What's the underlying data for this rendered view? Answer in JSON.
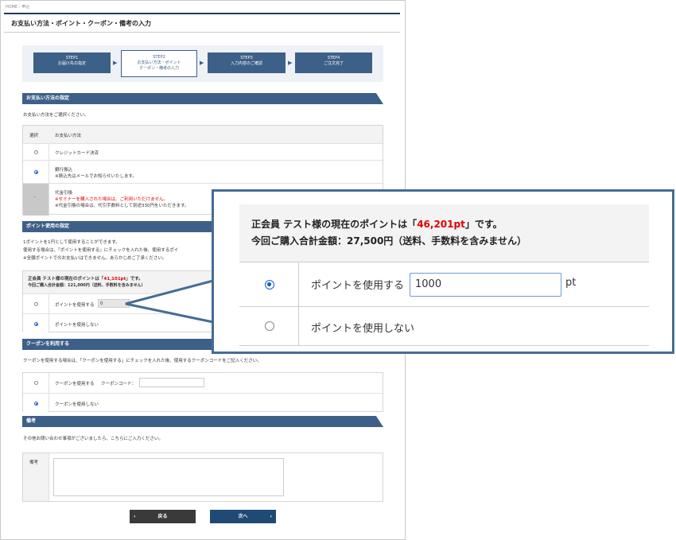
{
  "breadcrumb": {
    "home": "HOME",
    "current": "申込"
  },
  "page_title": "お支払い方法・ポイント・クーポン・備考の入力",
  "steps": [
    {
      "label": "STEP1",
      "desc": "お届け先の指定"
    },
    {
      "label": "STEP2",
      "desc": "お支払い方法・ポイント",
      "desc2": "クーポン・備考の入力"
    },
    {
      "label": "STEP3",
      "desc": "入力内容のご確認"
    },
    {
      "label": "STEP4",
      "desc": "ご注文完了"
    }
  ],
  "payment": {
    "heading": "お支払い方法の指定",
    "intro": "お支払い方法をご選択ください。",
    "col_select": "選択",
    "col_method": "お支払い方法",
    "options": {
      "credit": "クレジットカード決済",
      "bank": "銀行振込",
      "bank_note": "※振込先はメールでお知らせいたします。",
      "cod": "代金引換",
      "cod_note_red": "※セミナーを購入された場合は、ご利用いただけません。",
      "cod_note": "※代金引換の場合は、代引手数料として別途330円をいただきます。",
      "cod_dash": "-"
    }
  },
  "points": {
    "heading": "ポイント使用の指定",
    "desc1": "1ポイントを1円として使用することができます。",
    "desc2": "使用する場合は、「ポイントを使用する」にチェックを入れた後、使用するポイ",
    "desc3": "※全額ポイントでのお支払いはできません。あらかじめご了承ください。",
    "info_pre": "正会員 テスト様の現在のポイントは「",
    "info_pts": "41,101pt",
    "info_post": "」です。",
    "total": "今回ご購入合計金額：121,000円（送料、手数料を含みません）",
    "use_label": "ポイントを使用する",
    "use_value": "0",
    "nouse_label": "ポイントを使用しない"
  },
  "coupon": {
    "heading": "クーポンを利用する",
    "desc": "クーポンを使用する場合は、「クーポンを使用する」にチェックを入れた後、使用するクーポンコードをご記入ください。",
    "use_label": "クーポンを使用する",
    "code_label": "クーポンコード：",
    "code_value": "",
    "nouse_label": "クーポンを使用しない"
  },
  "remarks": {
    "heading": "備考",
    "desc": "その他お問い合わせ事項がございましたら、こちらにご入力ください。",
    "label": "備考",
    "value": ""
  },
  "buttons": {
    "back": "戻る",
    "back_icon": "‹",
    "next": "次へ",
    "next_icon": "›"
  },
  "zoom": {
    "info_pre": "正会員 テスト様の現在のポイントは「",
    "info_pts": "46,201pt",
    "info_post": "」です。",
    "total": "今回ご購入合計金額：27,500円（送料、手数料を含みません）",
    "use_label": "ポイントを使用する",
    "use_value": "1000",
    "unit": "pt",
    "nouse_label": "ポイントを使用しない"
  },
  "colors": {
    "accent": "#3d6089",
    "point_red": "#e00000",
    "callout_border": "#466d94"
  }
}
